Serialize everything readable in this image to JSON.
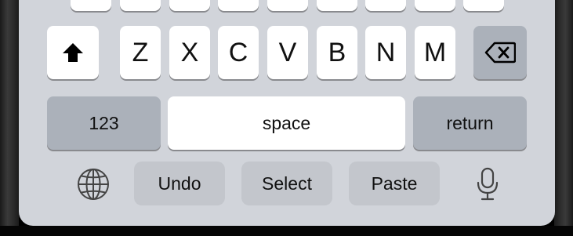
{
  "keyboard": {
    "letters": [
      "Z",
      "X",
      "C",
      "V",
      "B",
      "N",
      "M"
    ],
    "numbers_key": "123",
    "space_key": "space",
    "return_key": "return"
  },
  "toolbar": {
    "undo": "Undo",
    "select": "Select",
    "paste": "Paste"
  },
  "icons": {
    "shift": "shift-icon",
    "delete": "delete-icon",
    "globe": "globe-icon",
    "microphone": "microphone-icon"
  }
}
